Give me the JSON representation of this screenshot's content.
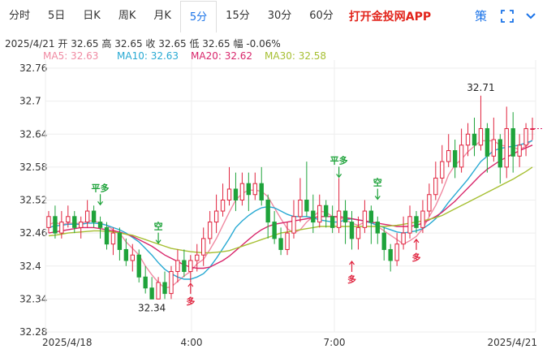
{
  "tabs": [
    {
      "label": "分时",
      "active": false
    },
    {
      "label": "5日",
      "active": false
    },
    {
      "label": "日K",
      "active": false
    },
    {
      "label": "周K",
      "active": false
    },
    {
      "label": "月K",
      "active": false
    },
    {
      "label": "5分",
      "active": true
    },
    {
      "label": "15分",
      "active": false
    },
    {
      "label": "30分",
      "active": false
    },
    {
      "label": "60分",
      "active": false
    }
  ],
  "promo": "打开金投网APP",
  "icons": [
    "strategy-icon",
    "fullscreen-icon",
    "expand-icon"
  ],
  "strategy_label": "策",
  "info_bar": {
    "date": "2025/4/21",
    "open_label": "开",
    "open": "32.65",
    "high_label": "高",
    "high": "32.65",
    "close_label": "收",
    "close": "32.65",
    "low_label": "低",
    "low": "32.65",
    "change_label": "幅",
    "change": "-0.06%"
  },
  "ma_legend": [
    {
      "text": "MA5: 32.63",
      "color": "#f08aa2"
    },
    {
      "text": "MA10: 32.63",
      "color": "#27a9d3"
    },
    {
      "text": "MA20: 32.62",
      "color": "#d8266b"
    },
    {
      "text": "MA30: 32.58",
      "color": "#a6bf32"
    }
  ],
  "chart_data": {
    "type": "candlestick",
    "y_ticks": [
      "32.76",
      "32.7",
      "32.64",
      "32.58",
      "32.52",
      "32.46",
      "32.4",
      "32.34",
      "32.28"
    ],
    "ylim": [
      32.28,
      32.76
    ],
    "x_labels": [
      "2025/4/18",
      "4:00",
      "7:00",
      "2025/4/21"
    ],
    "colors": {
      "up": "#e0233e",
      "down": "#1fa33b"
    },
    "candles": [
      [
        32.47,
        32.49,
        32.5,
        32.46
      ],
      [
        32.49,
        32.46,
        32.51,
        32.45
      ],
      [
        32.46,
        32.48,
        32.5,
        32.45
      ],
      [
        32.48,
        32.49,
        32.51,
        32.47
      ],
      [
        32.49,
        32.47,
        32.5,
        32.46
      ],
      [
        32.47,
        32.48,
        32.49,
        32.45
      ],
      [
        32.48,
        32.5,
        32.52,
        32.47
      ],
      [
        32.5,
        32.48,
        32.51,
        32.47
      ],
      [
        32.48,
        32.47,
        32.49,
        32.45
      ],
      [
        32.47,
        32.44,
        32.48,
        32.43
      ],
      [
        32.44,
        32.46,
        32.47,
        32.42
      ],
      [
        32.46,
        32.43,
        32.47,
        32.41
      ],
      [
        32.43,
        32.41,
        32.45,
        32.4
      ],
      [
        32.41,
        32.42,
        32.44,
        32.39
      ],
      [
        32.42,
        32.38,
        32.43,
        32.37
      ],
      [
        32.38,
        32.36,
        32.4,
        32.35
      ],
      [
        32.36,
        32.34,
        32.38,
        32.34
      ],
      [
        32.34,
        32.37,
        32.38,
        32.34
      ],
      [
        32.37,
        32.35,
        32.39,
        32.34
      ],
      [
        32.35,
        32.39,
        32.4,
        32.34
      ],
      [
        32.39,
        32.41,
        32.43,
        32.37
      ],
      [
        32.41,
        32.39,
        32.43,
        32.38
      ],
      [
        32.39,
        32.41,
        32.42,
        32.37
      ],
      [
        32.41,
        32.42,
        32.44,
        32.39
      ],
      [
        32.42,
        32.45,
        32.47,
        32.4
      ],
      [
        32.45,
        32.48,
        32.5,
        32.44
      ],
      [
        32.48,
        32.5,
        32.53,
        32.46
      ],
      [
        32.5,
        32.52,
        32.55,
        32.49
      ],
      [
        32.52,
        32.54,
        32.58,
        32.51
      ],
      [
        32.54,
        32.52,
        32.57,
        32.5
      ],
      [
        32.52,
        32.55,
        32.57,
        32.51
      ],
      [
        32.55,
        32.53,
        32.57,
        32.5
      ],
      [
        32.53,
        32.55,
        32.57,
        32.52
      ],
      [
        32.55,
        32.52,
        32.58,
        32.51
      ],
      [
        32.52,
        32.48,
        32.53,
        32.45
      ],
      [
        32.48,
        32.45,
        32.5,
        32.44
      ],
      [
        32.45,
        32.43,
        32.47,
        32.42
      ],
      [
        32.43,
        32.46,
        32.48,
        32.42
      ],
      [
        32.46,
        32.49,
        32.52,
        32.45
      ],
      [
        32.49,
        32.52,
        32.56,
        32.48
      ],
      [
        32.52,
        32.5,
        32.59,
        32.49
      ],
      [
        32.5,
        32.48,
        32.53,
        32.46
      ],
      [
        32.48,
        32.51,
        32.53,
        32.47
      ],
      [
        32.51,
        32.49,
        32.52,
        32.47
      ],
      [
        32.49,
        32.47,
        32.51,
        32.46
      ],
      [
        32.47,
        32.5,
        32.56,
        32.46
      ],
      [
        32.5,
        32.48,
        32.52,
        32.44
      ],
      [
        32.48,
        32.45,
        32.5,
        32.43
      ],
      [
        32.45,
        32.47,
        32.49,
        32.43
      ],
      [
        32.47,
        32.5,
        32.52,
        32.46
      ],
      [
        32.5,
        32.48,
        32.51,
        32.44
      ],
      [
        32.48,
        32.46,
        32.49,
        32.44
      ],
      [
        32.46,
        32.43,
        32.47,
        32.41
      ],
      [
        32.43,
        32.41,
        32.44,
        32.39
      ],
      [
        32.41,
        32.44,
        32.46,
        32.4
      ],
      [
        32.44,
        32.46,
        32.49,
        32.43
      ],
      [
        32.46,
        32.49,
        32.51,
        32.45
      ],
      [
        32.49,
        32.47,
        32.5,
        32.46
      ],
      [
        32.47,
        32.5,
        32.52,
        32.46
      ],
      [
        32.5,
        32.53,
        32.55,
        32.49
      ],
      [
        32.53,
        32.56,
        32.59,
        32.52
      ],
      [
        32.56,
        32.59,
        32.62,
        32.55
      ],
      [
        32.59,
        32.61,
        32.64,
        32.58
      ],
      [
        32.61,
        32.58,
        32.63,
        32.56
      ],
      [
        32.58,
        32.62,
        32.65,
        32.57
      ],
      [
        32.62,
        32.64,
        32.66,
        32.6
      ],
      [
        32.64,
        32.62,
        32.67,
        32.6
      ],
      [
        32.62,
        32.65,
        32.71,
        32.61
      ],
      [
        32.65,
        32.6,
        32.66,
        32.57
      ],
      [
        32.6,
        32.63,
        32.67,
        32.59
      ],
      [
        32.63,
        32.58,
        32.64,
        32.55
      ],
      [
        32.58,
        32.65,
        32.69,
        32.56
      ],
      [
        32.65,
        32.6,
        32.68,
        32.57
      ],
      [
        32.6,
        32.62,
        32.64,
        32.58
      ],
      [
        32.62,
        32.65,
        32.66,
        32.6
      ],
      [
        32.65,
        32.65,
        32.67,
        32.63
      ]
    ],
    "ma": [
      {
        "name": "MA5",
        "color": "#f08aa2",
        "values": [
          32.475,
          32.48,
          32.475,
          32.478,
          32.478,
          32.477,
          32.482,
          32.482,
          32.478,
          32.474,
          32.466,
          32.46,
          32.444,
          32.432,
          32.42,
          32.4,
          32.384,
          32.37,
          32.36,
          32.362,
          32.372,
          32.382,
          32.39,
          32.404,
          32.412,
          32.43,
          32.45,
          32.474,
          32.498,
          32.52,
          32.532,
          32.538,
          32.538,
          32.536,
          32.526,
          32.506,
          32.486,
          32.468,
          32.46,
          32.466,
          32.48,
          32.49,
          32.5,
          32.498,
          32.49,
          32.488,
          32.484,
          32.478,
          32.474,
          32.48,
          32.48,
          32.472,
          32.464,
          32.456,
          32.448,
          32.44,
          32.446,
          32.454,
          32.468,
          32.49,
          32.51,
          32.536,
          32.566,
          32.584,
          32.594,
          32.608,
          32.618,
          32.628,
          32.628,
          32.628,
          32.62,
          32.618,
          32.616,
          32.612,
          32.618,
          32.63
        ]
      },
      {
        "name": "MA10",
        "color": "#27a9d3",
        "values": [
          32.47,
          32.473,
          32.474,
          32.476,
          32.476,
          32.476,
          32.478,
          32.478,
          32.477,
          32.474,
          32.47,
          32.466,
          32.46,
          32.452,
          32.444,
          32.432,
          32.42,
          32.406,
          32.394,
          32.386,
          32.38,
          32.376,
          32.376,
          32.38,
          32.386,
          32.398,
          32.414,
          32.432,
          32.45,
          32.47,
          32.482,
          32.492,
          32.5,
          32.506,
          32.508,
          32.506,
          32.5,
          32.494,
          32.49,
          32.49,
          32.49,
          32.488,
          32.484,
          32.482,
          32.48,
          32.48,
          32.484,
          32.486,
          32.484,
          32.482,
          32.478,
          32.474,
          32.47,
          32.466,
          32.462,
          32.46,
          32.462,
          32.464,
          32.468,
          32.476,
          32.486,
          32.5,
          32.516,
          32.53,
          32.544,
          32.558,
          32.574,
          32.59,
          32.6,
          32.61,
          32.614,
          32.616,
          32.618,
          32.62,
          32.624,
          32.628
        ]
      },
      {
        "name": "MA20",
        "color": "#d8266b",
        "values": [
          32.46,
          32.462,
          32.464,
          32.466,
          32.468,
          32.47,
          32.47,
          32.47,
          32.468,
          32.466,
          32.464,
          32.462,
          32.458,
          32.454,
          32.448,
          32.442,
          32.436,
          32.428,
          32.42,
          32.414,
          32.408,
          32.402,
          32.398,
          32.396,
          32.396,
          32.398,
          32.404,
          32.41,
          32.418,
          32.428,
          32.438,
          32.448,
          32.458,
          32.466,
          32.472,
          32.476,
          32.478,
          32.48,
          32.482,
          32.484,
          32.486,
          32.488,
          32.49,
          32.49,
          32.49,
          32.49,
          32.488,
          32.486,
          32.484,
          32.482,
          32.48,
          32.478,
          32.476,
          32.474,
          32.472,
          32.472,
          32.472,
          32.474,
          32.478,
          32.484,
          32.49,
          32.498,
          32.508,
          32.518,
          32.53,
          32.542,
          32.554,
          32.566,
          32.576,
          32.584,
          32.592,
          32.598,
          32.604,
          32.61,
          32.615,
          32.62
        ]
      },
      {
        "name": "MA30",
        "color": "#a6bf32",
        "values": [
          32.455,
          32.456,
          32.458,
          32.46,
          32.461,
          32.462,
          32.463,
          32.464,
          32.464,
          32.463,
          32.462,
          32.46,
          32.458,
          32.456,
          32.452,
          32.448,
          32.444,
          32.44,
          32.436,
          32.432,
          32.43,
          32.428,
          32.426,
          32.425,
          32.424,
          32.424,
          32.425,
          32.426,
          32.428,
          32.432,
          32.436,
          32.44,
          32.444,
          32.448,
          32.452,
          32.456,
          32.46,
          32.462,
          32.464,
          32.466,
          32.468,
          32.47,
          32.472,
          32.472,
          32.472,
          32.472,
          32.472,
          32.472,
          32.472,
          32.472,
          32.472,
          32.472,
          32.472,
          32.473,
          32.474,
          32.476,
          32.478,
          32.48,
          32.482,
          32.485,
          32.488,
          32.492,
          32.498,
          32.504,
          32.51,
          32.516,
          32.522,
          32.528,
          32.534,
          32.54,
          32.546,
          32.552,
          32.558,
          32.565,
          32.572,
          32.58
        ]
      }
    ],
    "annotations": [
      {
        "text": "平多",
        "color": "#1fa33b",
        "arrow": "down",
        "index": 8,
        "price": 32.51
      },
      {
        "text": "空",
        "color": "#1fa33b",
        "arrow": "down",
        "index": 17,
        "price": 32.44
      },
      {
        "text": "多",
        "color": "#e0233e",
        "arrow": "up",
        "index": 22,
        "price": 32.37
      },
      {
        "text": "平多",
        "color": "#1fa33b",
        "arrow": "down",
        "index": 45,
        "price": 32.56
      },
      {
        "text": "多",
        "color": "#e0233e",
        "arrow": "up",
        "index": 47,
        "price": 32.41
      },
      {
        "text": "空",
        "color": "#1fa33b",
        "arrow": "down",
        "index": 51,
        "price": 32.52
      },
      {
        "text": "多",
        "color": "#e0233e",
        "arrow": "up",
        "index": 57,
        "price": 32.45
      }
    ],
    "price_labels": [
      {
        "text": "32.71",
        "index": 67,
        "price": 32.71
      },
      {
        "text": "32.34",
        "index": 16,
        "price": 32.34
      }
    ]
  }
}
